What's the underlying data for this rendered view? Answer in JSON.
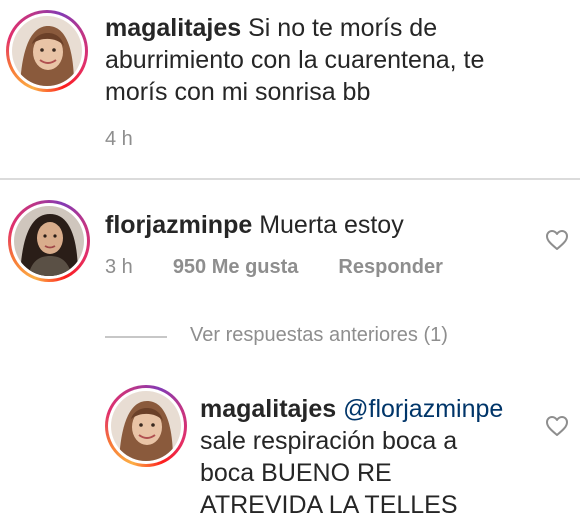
{
  "comments": [
    {
      "username": "magalitajes",
      "text_line1": " Si no te morís de",
      "text_line2": "aburrimiento con la cuarentena, te",
      "text_line3": "morís con mi sonrisa bb",
      "time": "4 h"
    },
    {
      "username": "florjazminpe",
      "text": " Muerta estoy",
      "time": "3 h",
      "likes": "950 Me gusta",
      "reply_label": "Responder"
    }
  ],
  "view_replies": "Ver respuestas anteriores (1)",
  "reply": {
    "username": "magalitajes",
    "mention": "@florjazminpe",
    "line2": "sale respiración boca a",
    "line3": "boca BUENO RE",
    "line4": "ATREVIDA LA TELLES"
  },
  "colors": {
    "text": "#262626",
    "secondary": "#8e8e8e",
    "mention": "#003569",
    "divider": "#dbdbdb"
  },
  "icons": [
    "heart-icon"
  ]
}
